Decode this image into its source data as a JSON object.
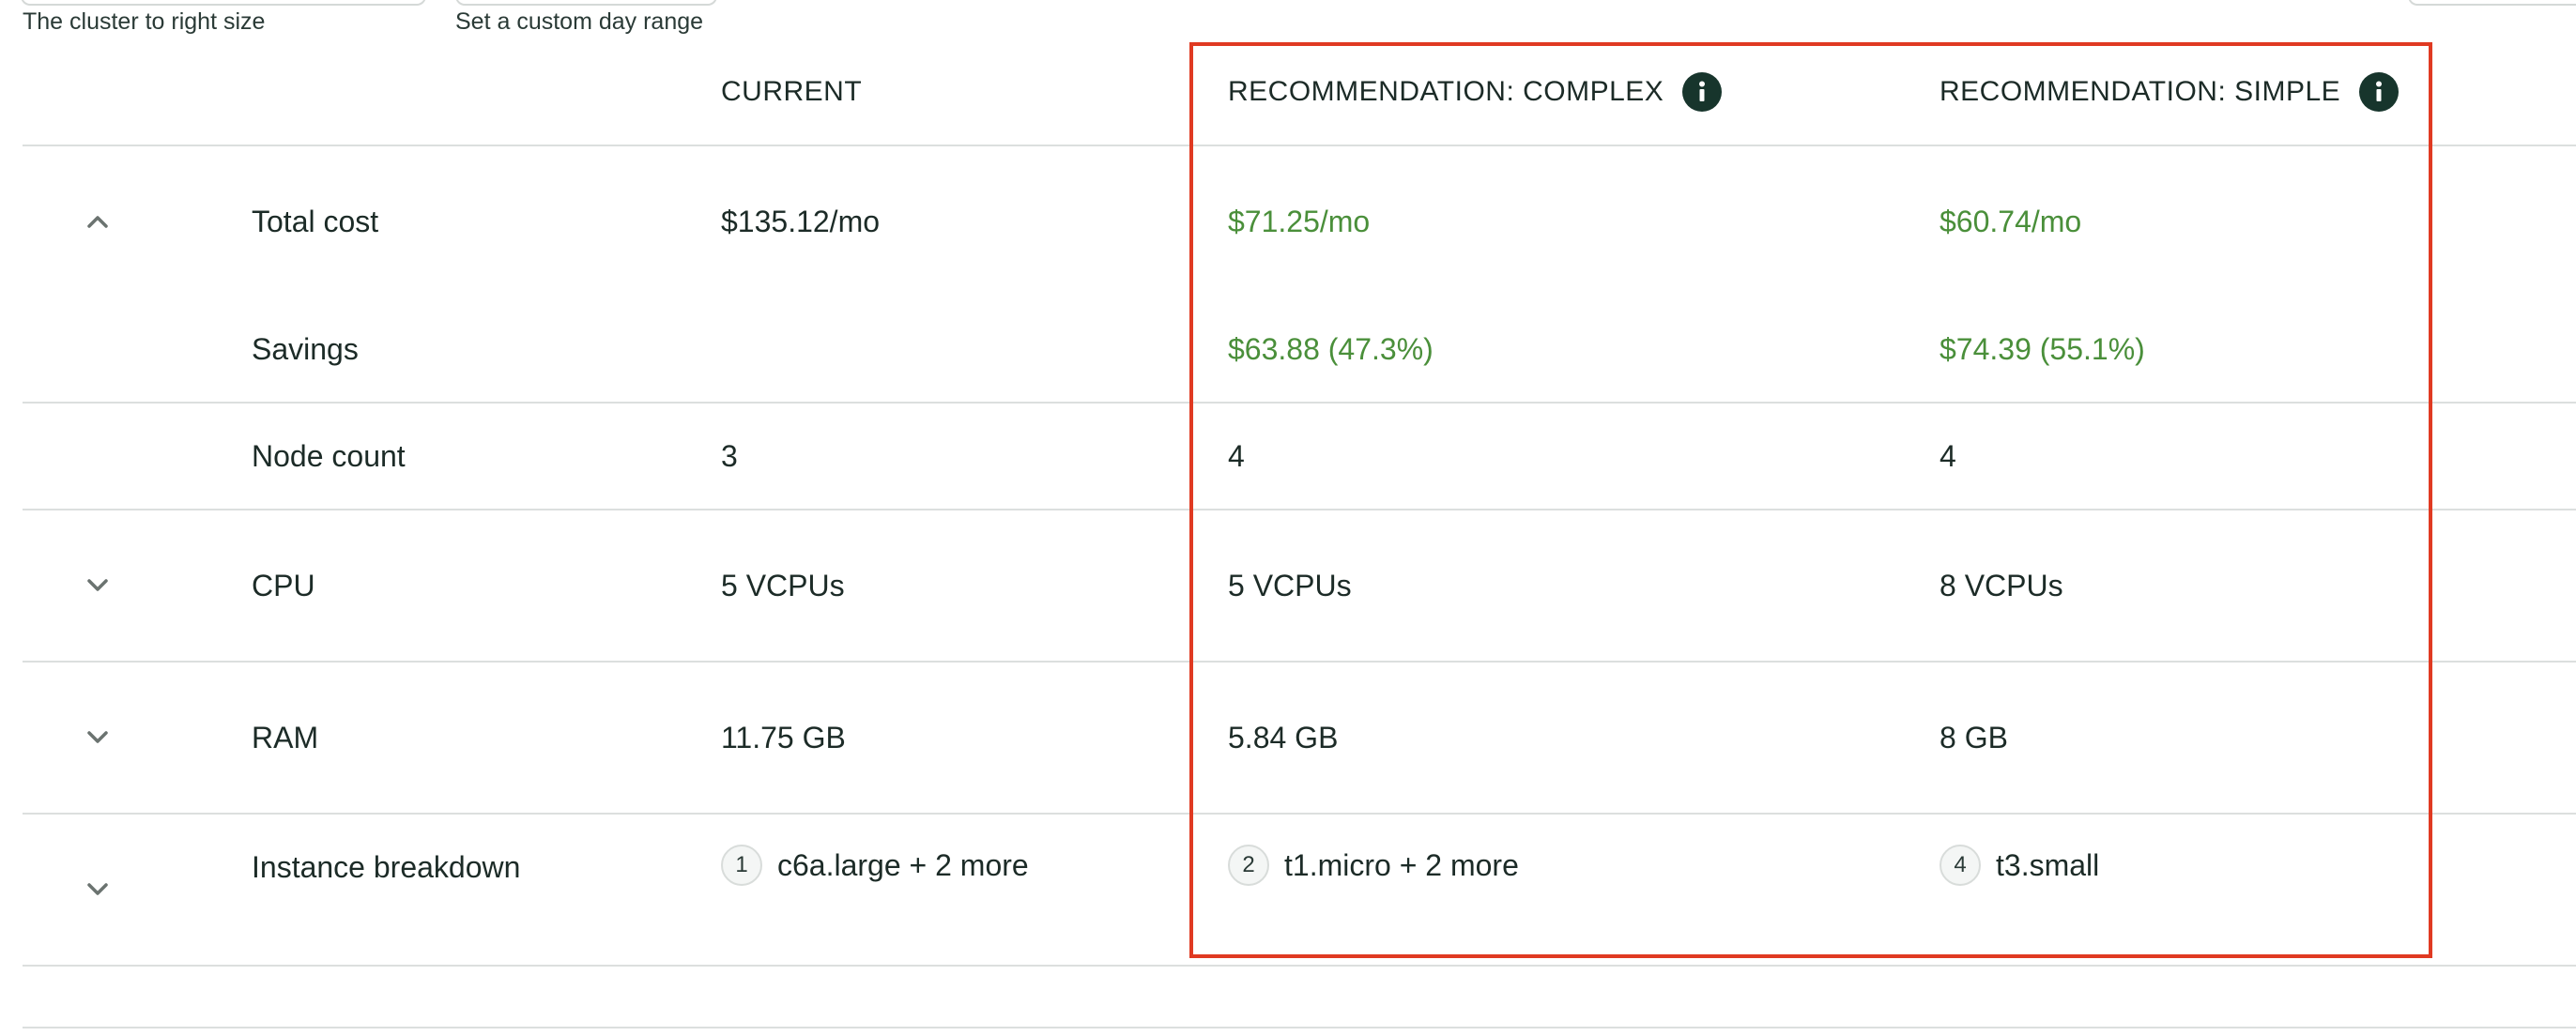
{
  "filters": {
    "cluster_helper": "The cluster to right size",
    "range_helper": "Set a custom day range"
  },
  "columns": {
    "current": "CURRENT",
    "complex": "RECOMMENDATION: COMPLEX",
    "simple": "RECOMMENDATION: SIMPLE"
  },
  "rows": {
    "total_cost": {
      "label": "Total cost",
      "current": "$135.12/mo",
      "complex": "$71.25/mo",
      "simple": "$60.74/mo"
    },
    "savings": {
      "label": "Savings",
      "current": "",
      "complex": "$63.88 (47.3%)",
      "simple": "$74.39 (55.1%)"
    },
    "node_count": {
      "label": "Node count",
      "current": "3",
      "complex": "4",
      "simple": "4"
    },
    "cpu": {
      "label": "CPU",
      "current": "5 VCPUs",
      "complex": "5 VCPUs",
      "simple": "8 VCPUs"
    },
    "ram": {
      "label": "RAM",
      "current": "11.75 GB",
      "complex": "5.84 GB",
      "simple": "8 GB"
    },
    "instance_breakdown": {
      "label": "Instance breakdown",
      "current": {
        "count": "1",
        "text": "c6a.large + 2 more"
      },
      "complex": {
        "count": "2",
        "text": "t1.micro + 2 more"
      },
      "simple": {
        "count": "4",
        "text": "t3.small"
      }
    }
  },
  "icons": {
    "expand": "chevron-up-icon",
    "collapse": "chevron-down-icon",
    "info": "info-icon"
  },
  "colors": {
    "savings_green": "#4a8f3a",
    "highlight_red": "#e03a22",
    "info_dark": "#17352c"
  }
}
